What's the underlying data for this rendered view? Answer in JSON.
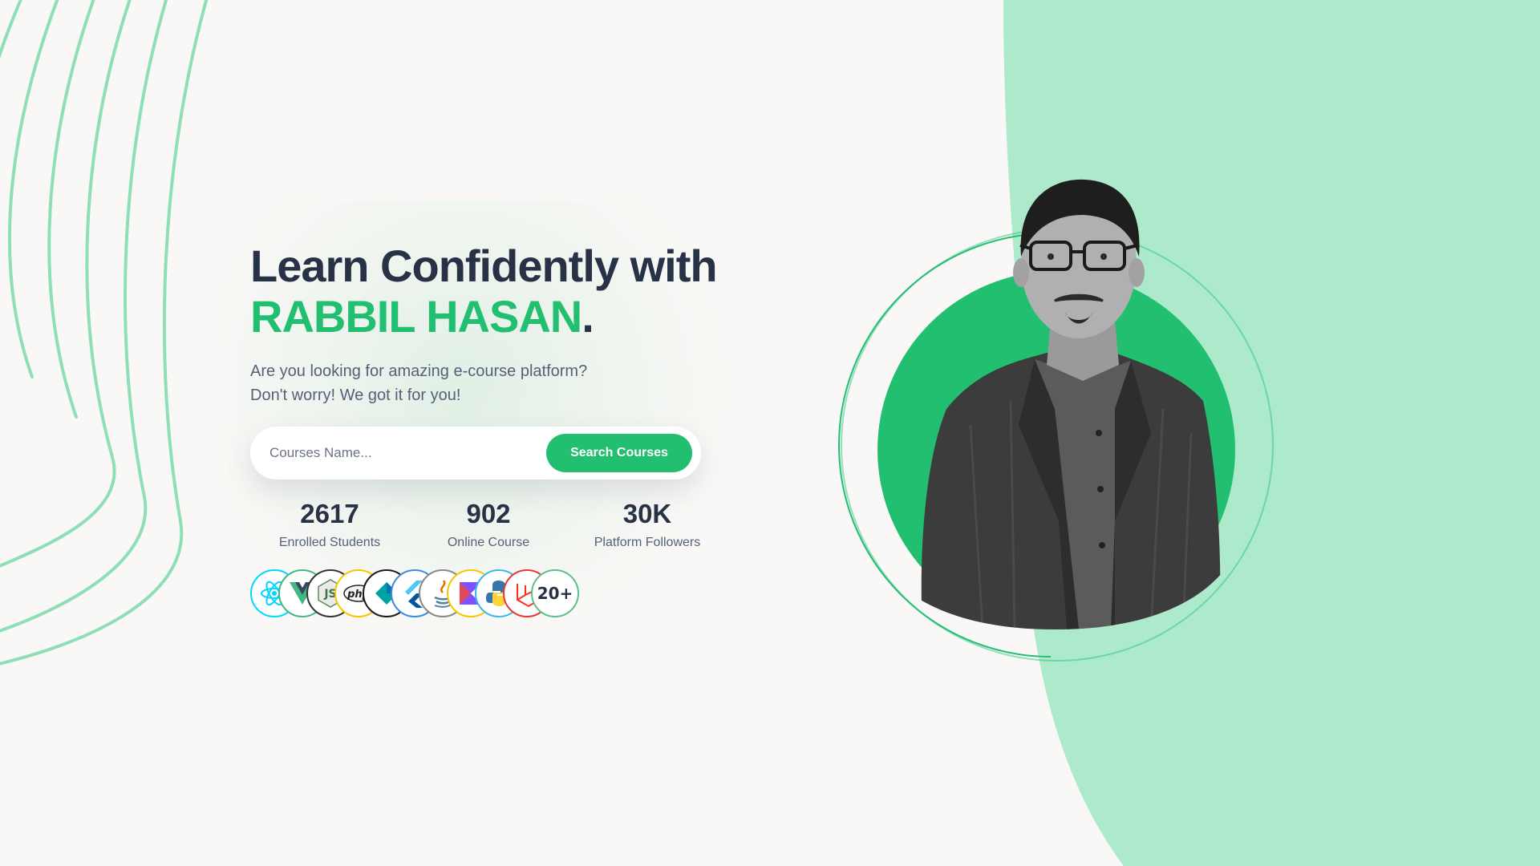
{
  "hero": {
    "title_line1": "Learn Confidently with",
    "title_name": "RABBIL HASAN",
    "title_dot": ".",
    "subtitle_line1": "Are you looking for amazing e-course platform?",
    "subtitle_line2": "Don't worry! We got it for you!"
  },
  "search": {
    "placeholder": "Courses Name...",
    "value": "",
    "button_label": "Search Courses"
  },
  "stats": [
    {
      "value": "2617",
      "label": "Enrolled Students"
    },
    {
      "value": "902",
      "label": "Online Course"
    },
    {
      "value": "30K",
      "label": "Platform Followers"
    }
  ],
  "tech_icons": [
    {
      "icon": "react-icon",
      "color": "#00d8ff"
    },
    {
      "icon": "vue-icon",
      "color": "#41b883"
    },
    {
      "icon": "nodejs-icon",
      "color": "#333333"
    },
    {
      "icon": "php-icon",
      "color": "#f7c600"
    },
    {
      "icon": "kotlin-icon",
      "color": "#1a1a1a"
    },
    {
      "icon": "flutter-icon",
      "color": "#3b8bdb"
    },
    {
      "icon": "java-icon",
      "color": "#888888"
    },
    {
      "icon": "kotlin-k-icon",
      "color": "#f7c600"
    },
    {
      "icon": "python-icon",
      "color": "#3ab7e8"
    },
    {
      "icon": "laravel-icon",
      "color": "#e53935"
    }
  ],
  "tech_count": "20+",
  "colors": {
    "accent": "#22bf71",
    "heading": "#283246",
    "blob": "#adeacb",
    "background": "#f9f8f6"
  }
}
